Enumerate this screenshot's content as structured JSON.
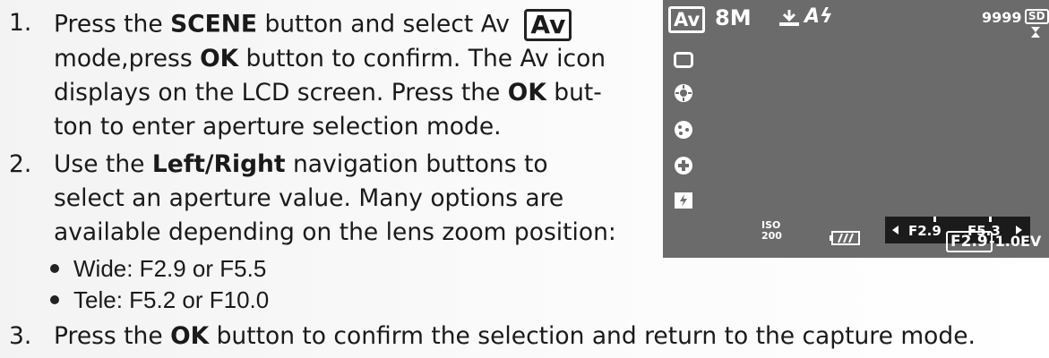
{
  "steps": {
    "s1": {
      "num": "1.",
      "l1_a": "Press the ",
      "l1_b": "SCENE",
      "l1_c": " button and select Av",
      "badge": "Av",
      "l2_a": "mode,press ",
      "l2_b": "OK",
      "l2_c": " button to confirm. The Av icon",
      "l3": "displays on the LCD screen. Press the ",
      "l3_b": "OK",
      "l3_c": " but-",
      "l4": "ton to enter aperture selection mode."
    },
    "s2": {
      "num": "2.",
      "l1_a": " Use the ",
      "l1_b": "Left/Right",
      "l1_c": " navigation buttons to",
      "l2": "select an aperture value. Many options are",
      "l3": "available depending on the lens zoom position:",
      "b1": "Wide: F2.9 or F5.5",
      "b2": "Tele: F5.2 or F10.0"
    },
    "s3": {
      "num": "3.",
      "a": "Press the ",
      "b": "OK",
      "c": " button to confirm the selection and return to the capture mode."
    }
  },
  "lcd": {
    "mode": "Av",
    "size": "8M",
    "flash": "Aϟ",
    "shots": "9999",
    "card": "SD",
    "iso_top": "ISO",
    "iso_val": "200",
    "ap_left": "F2.9",
    "ap_right": "F5.3",
    "ap_cur": "F2.9",
    "ev": "-1.0EV",
    "colors": {
      "screen": "#6b6b6b",
      "slider": "#1b1b1b"
    }
  }
}
